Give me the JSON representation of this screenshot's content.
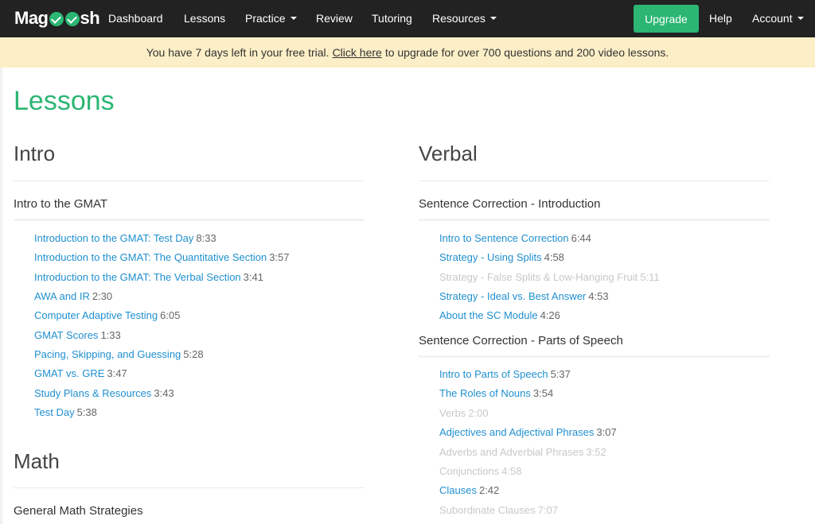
{
  "nav": {
    "logo": "Magoosh",
    "items": [
      "Dashboard",
      "Lessons",
      "Practice",
      "Review",
      "Tutoring",
      "Resources"
    ],
    "upgrade": "Upgrade",
    "help": "Help",
    "account": "Account"
  },
  "banner": {
    "prefix": "You have 7 days left in your free trial.",
    "link": "Click here",
    "suffix": "to upgrade for over 700 questions and 200 video lessons."
  },
  "page_title": "Lessons",
  "intro": {
    "title": "Intro",
    "sub1": "Intro to the GMAT",
    "lessons": [
      {
        "title": "Introduction to the GMAT: Test Day",
        "duration": "8:33"
      },
      {
        "title": "Introduction to the GMAT: The Quantitative Section",
        "duration": "3:57"
      },
      {
        "title": "Introduction to the GMAT: The Verbal Section",
        "duration": "3:41"
      },
      {
        "title": "AWA and IR",
        "duration": "2:30"
      },
      {
        "title": "Computer Adaptive Testing",
        "duration": "6:05"
      },
      {
        "title": "GMAT Scores",
        "duration": "1:33"
      },
      {
        "title": "Pacing, Skipping, and Guessing",
        "duration": "5:28"
      },
      {
        "title": "GMAT vs. GRE",
        "duration": "3:47"
      },
      {
        "title": "Study Plans & Resources",
        "duration": "3:43"
      },
      {
        "title": "Test Day",
        "duration": "5:38"
      }
    ]
  },
  "math": {
    "title": "Math",
    "sub1": "General Math Strategies"
  },
  "verbal": {
    "title": "Verbal",
    "sub1": "Sentence Correction - Introduction",
    "lessons1": [
      {
        "title": "Intro to Sentence Correction",
        "duration": "6:44"
      },
      {
        "title": "Strategy - Using Splits",
        "duration": "4:58"
      },
      {
        "title": "Strategy - False Splits & Low-Hanging Fruit",
        "duration": "5:11"
      },
      {
        "title": "Strategy - Ideal vs. Best Answer",
        "duration": "4:53"
      },
      {
        "title": "About the SC Module",
        "duration": "4:26"
      }
    ],
    "sub2": "Sentence Correction - Parts of Speech",
    "lessons2": [
      {
        "title": "Intro to Parts of Speech",
        "duration": "5:37"
      },
      {
        "title": "The Roles of Nouns",
        "duration": "3:54"
      },
      {
        "title": "Verbs",
        "duration": "2:00"
      },
      {
        "title": "Adjectives and Adjectival Phrases",
        "duration": "3:07"
      },
      {
        "title": "Adverbs and Adverbial Phrases",
        "duration": "3:52"
      },
      {
        "title": "Conjunctions",
        "duration": "4:58"
      },
      {
        "title": "Clauses",
        "duration": "2:42"
      },
      {
        "title": "Subordinate Clauses",
        "duration": "7:07"
      }
    ]
  }
}
